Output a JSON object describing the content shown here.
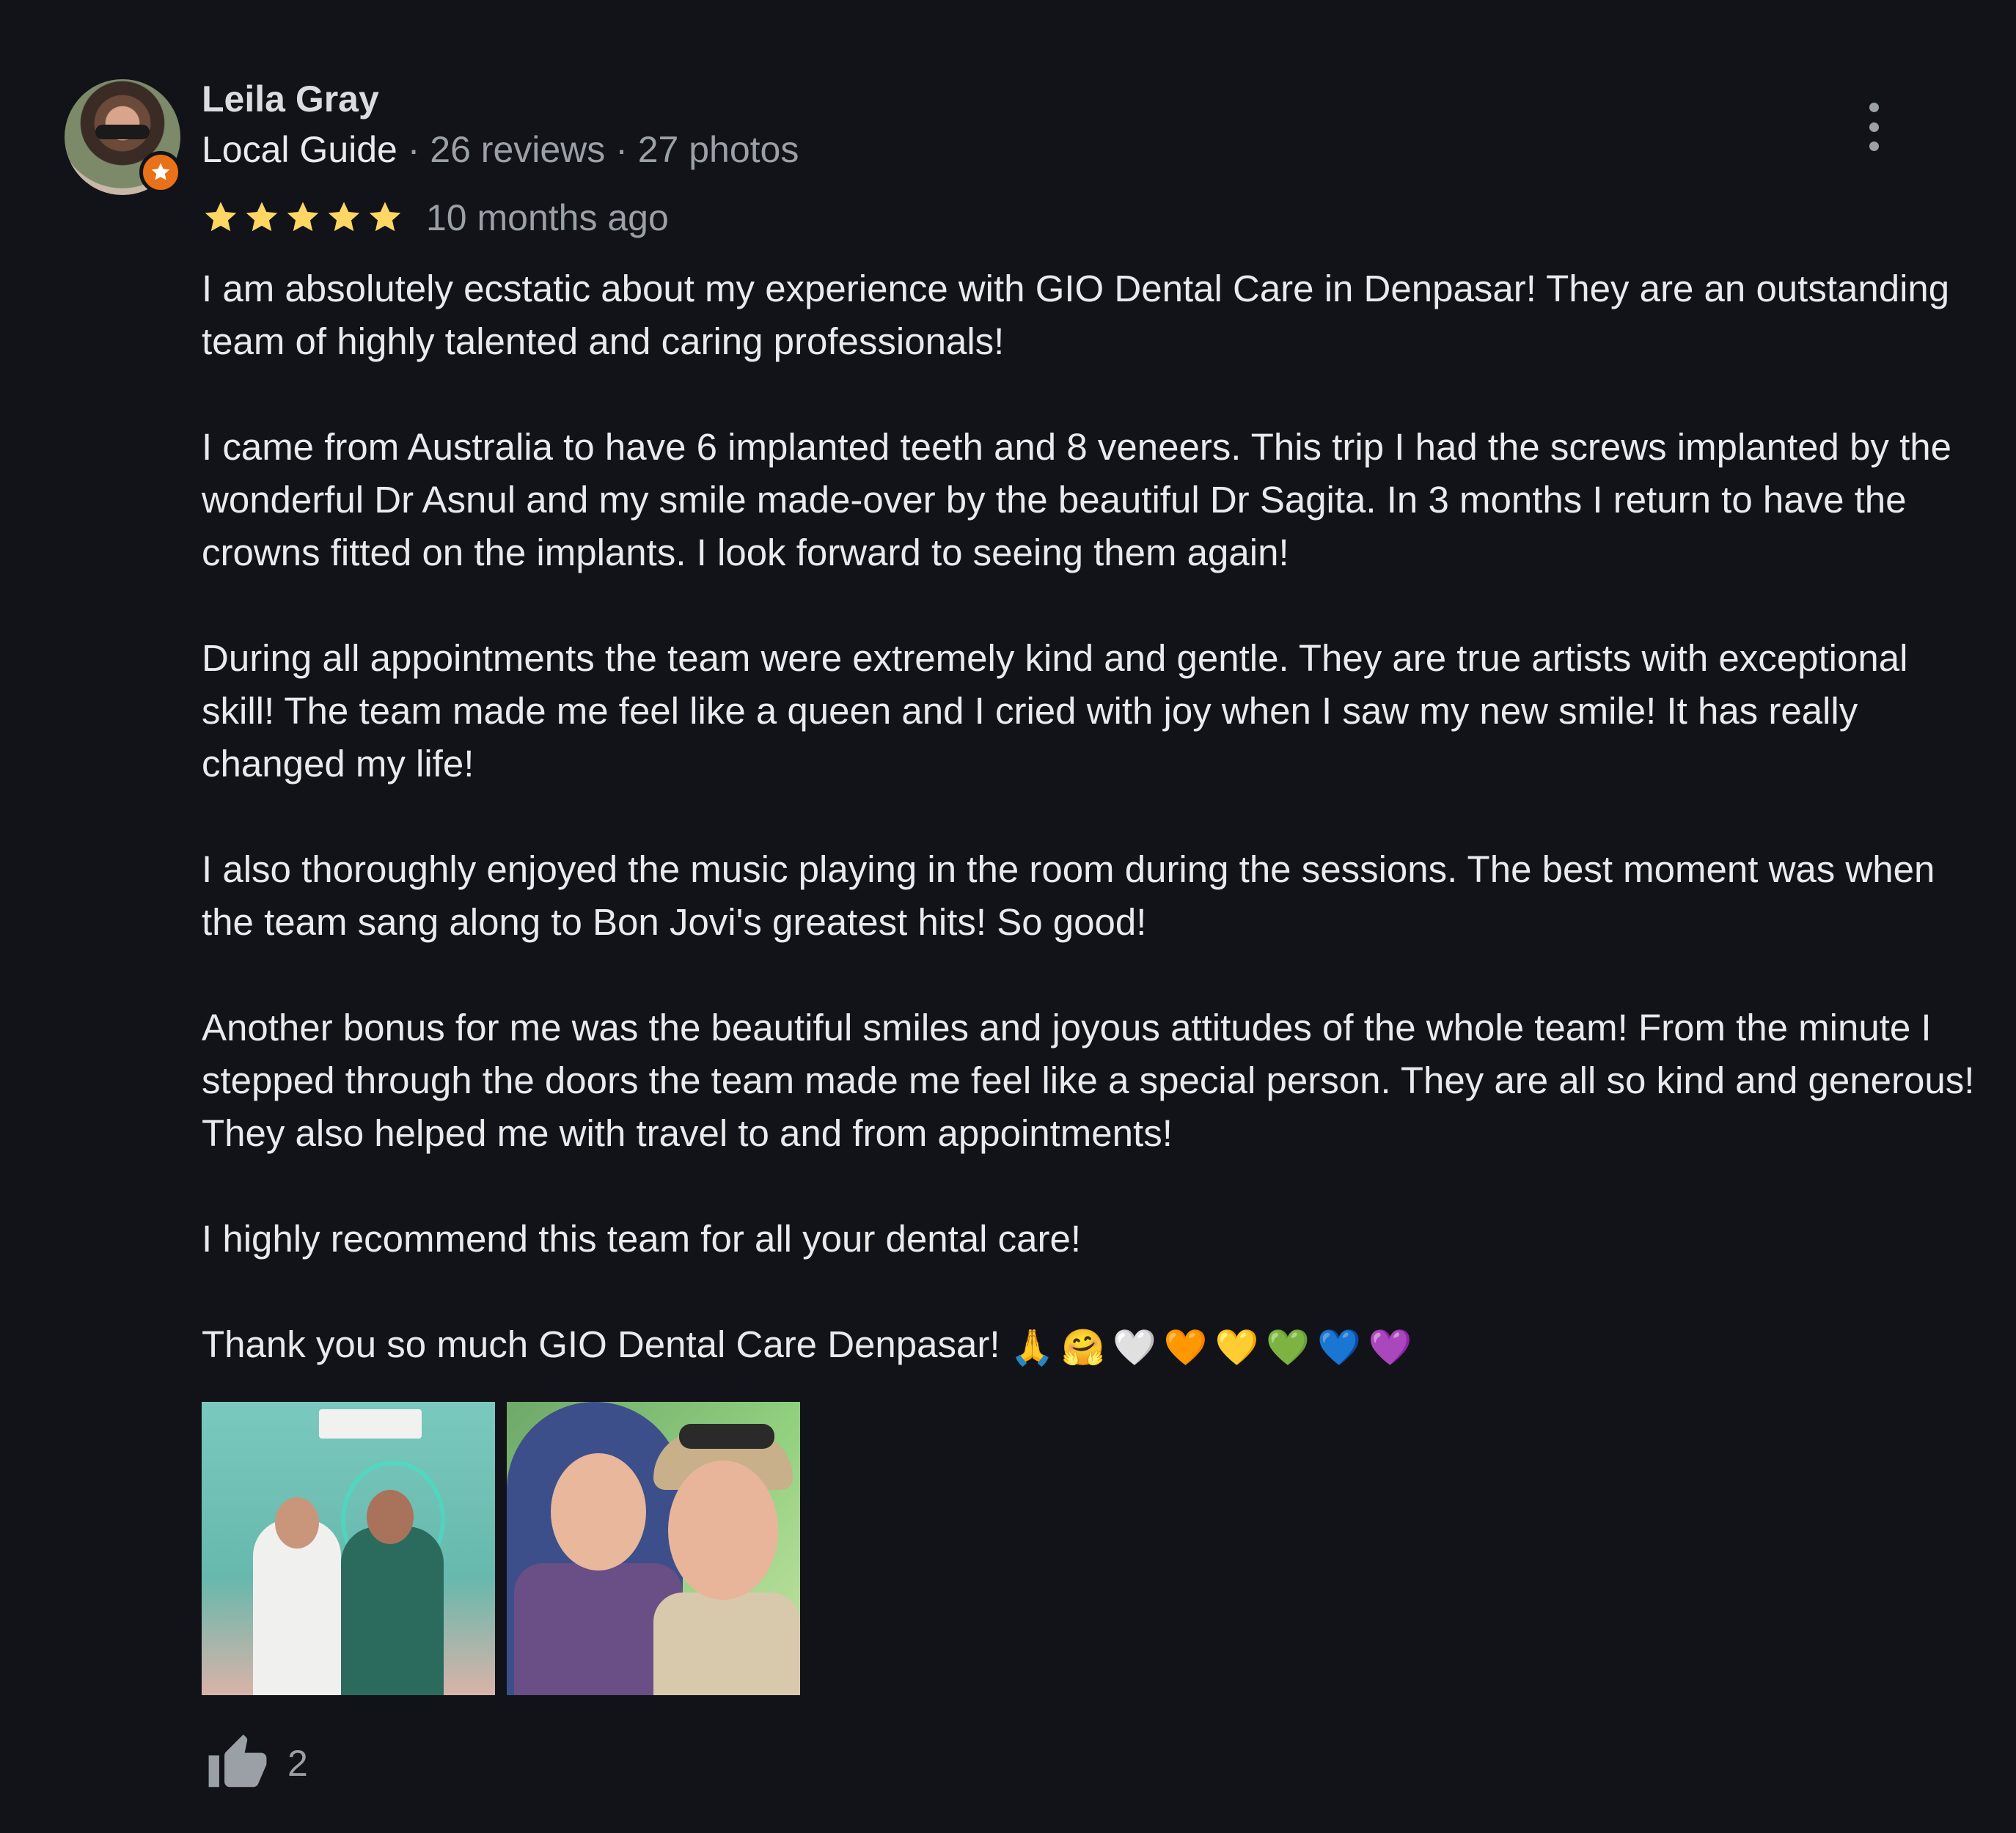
{
  "reviewer": {
    "name": "Leila Gray",
    "level": "Local Guide",
    "sep1": " · ",
    "reviews": "26 reviews",
    "sep2": " · ",
    "photos": "27 photos"
  },
  "rating": {
    "stars": 5,
    "max_stars": 5,
    "star_color": "#fdd663",
    "time": "10 months ago"
  },
  "review": {
    "paragraphs": [
      "I am absolutely ecstatic about my experience with GIO Dental Care in Denpasar! They are an outstanding team of highly talented and caring professionals!",
      "I came from Australia to have 6 implanted teeth and 8 veneers. This trip I had the screws implanted by the wonderful Dr Asnul and my smile made-over by the beautiful Dr Sagita. In 3 months I return to have the crowns fitted on the implants. I look forward to seeing them again!",
      "During all appointments the team were extremely kind and gentle. They are true artists with exceptional skill! The team made me feel like a queen and I cried with joy when I saw my new smile! It has really changed my life!",
      "I also thoroughly enjoyed the music playing in the room during the sessions. The best moment was when the team sang along to Bon Jovi's greatest hits! So good!",
      "Another bonus for me was the beautiful smiles and joyous attitudes of the whole team! From the minute I stepped through the doors the team made me feel like a special person. They are all so kind and generous! They also helped me with travel to and from appointments!",
      "I highly recommend this team for all your dental care!"
    ],
    "closing": "Thank you so much GIO Dental Care Denpasar!",
    "emojis": {
      "pray": "🙏",
      "hug": "🤗",
      "white_heart": "🤍",
      "orange_heart": "🧡",
      "yellow_heart": "💛",
      "green_heart": "💚",
      "blue_heart": "💙",
      "purple_heart": "💜"
    },
    "heart_colors": [
      "#f1f1f1",
      "#f4731f",
      "#ffd500",
      "#35c11a",
      "#1e88e5",
      "#9c6cd9"
    ]
  },
  "photos_count_shown": 2,
  "likes": {
    "count": "2"
  },
  "badge_color": "#e8711a"
}
